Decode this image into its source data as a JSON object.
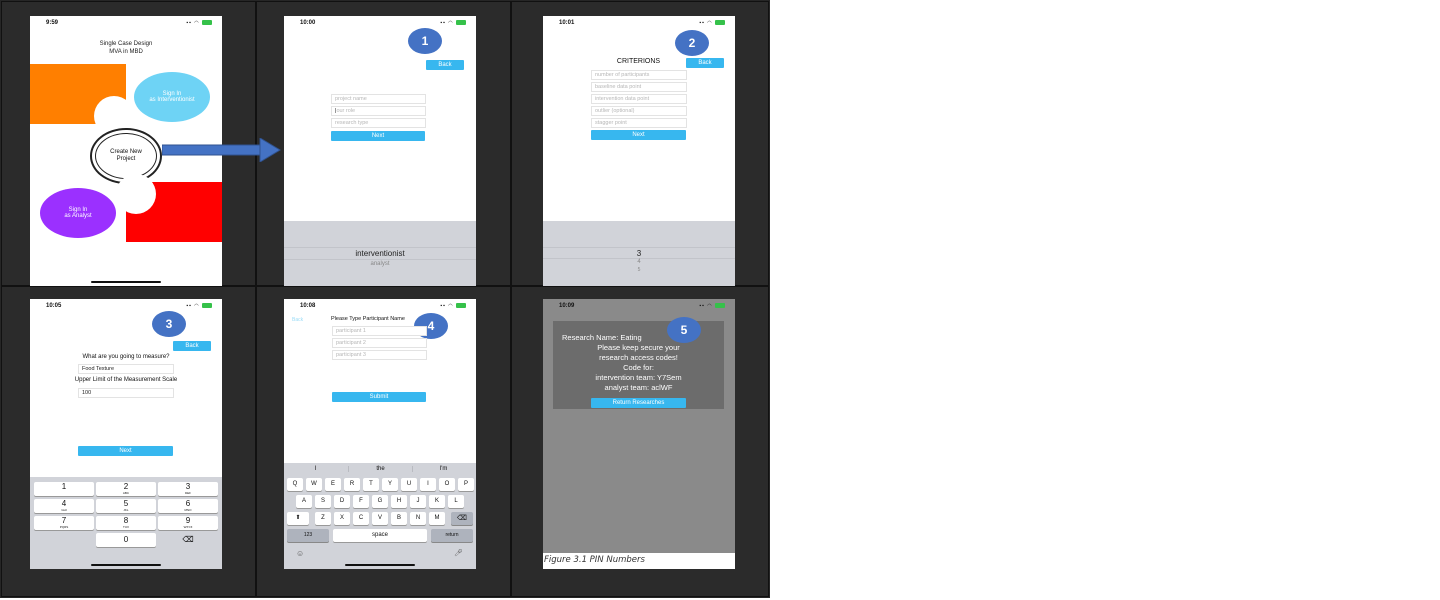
{
  "colors": {
    "accent_blue": "#37b7ef",
    "badge_blue": "#4472c4",
    "orange": "#ff7f00",
    "red": "#ff0000",
    "purple": "#9b30ff",
    "light_blue": "#6ed3f5"
  },
  "screen1": {
    "time": "9:59",
    "title_line1": "Single Case Design",
    "title_line2": "MVA in MBD",
    "sign_in_interventionist_line1": "Sign In",
    "sign_in_interventionist_line2": "as Interventionist",
    "create_line1": "Create New",
    "create_line2": "Project",
    "sign_in_analyst_line1": "Sign In",
    "sign_in_analyst_line2": "as Analyst"
  },
  "screen2": {
    "time": "10:00",
    "badge": "1",
    "back": "Back",
    "fields": [
      "project name",
      "our role",
      "research type"
    ],
    "next": "Next",
    "picker_selected": "interventionist",
    "picker_next": "analyst"
  },
  "screen3": {
    "time": "10:01",
    "badge": "2",
    "heading": "CRITERIONS",
    "back": "Back",
    "fields": [
      "number of participants",
      "baseline data point",
      "intervention data point",
      "outlier (optional)",
      "stagger point"
    ],
    "next": "Next",
    "picker_values": [
      "3",
      "4",
      "5"
    ]
  },
  "screen4": {
    "time": "10:05",
    "badge": "3",
    "back": "Back",
    "question1": "What are you going to measure?",
    "answer1": "Food Texture",
    "question2": "Upper Limit of the Measurement Scale",
    "answer2": "100",
    "next": "Next",
    "keypad": [
      {
        "num": "1",
        "letters": ""
      },
      {
        "num": "2",
        "letters": "ABC"
      },
      {
        "num": "3",
        "letters": "DEF"
      },
      {
        "num": "4",
        "letters": "GHI"
      },
      {
        "num": "5",
        "letters": "JKL"
      },
      {
        "num": "6",
        "letters": "MNO"
      },
      {
        "num": "7",
        "letters": "PQRS"
      },
      {
        "num": "8",
        "letters": "TUV"
      },
      {
        "num": "9",
        "letters": "WXYZ"
      }
    ],
    "zero": "0",
    "delete": "⌫"
  },
  "screen5": {
    "time": "10:08",
    "badge": "4",
    "back": "Back",
    "prompt": "Please Type Participant Name",
    "fields": [
      "participant 1",
      "participant 2",
      "participant 3"
    ],
    "submit": "Submit",
    "suggestions": [
      "I",
      "the",
      "I'm"
    ],
    "row1": [
      "Q",
      "W",
      "E",
      "R",
      "T",
      "Y",
      "U",
      "I",
      "O",
      "P"
    ],
    "row2": [
      "A",
      "S",
      "D",
      "F",
      "G",
      "H",
      "J",
      "K",
      "L"
    ],
    "row3": [
      "Z",
      "X",
      "C",
      "V",
      "B",
      "N",
      "M"
    ],
    "num_key": "123",
    "space": "space",
    "return": "return"
  },
  "screen6": {
    "time": "10:09",
    "badge": "5",
    "line1": "Research Name: Eating",
    "line2": "Please keep secure your",
    "line3": "research access codes!",
    "line4": "Code for:",
    "line5": "intervention team: Y7Sem",
    "line6": "analyst team: aclWF",
    "return_button": "Return Researches"
  },
  "caption": "Figure 3.1 PIN Numbers"
}
